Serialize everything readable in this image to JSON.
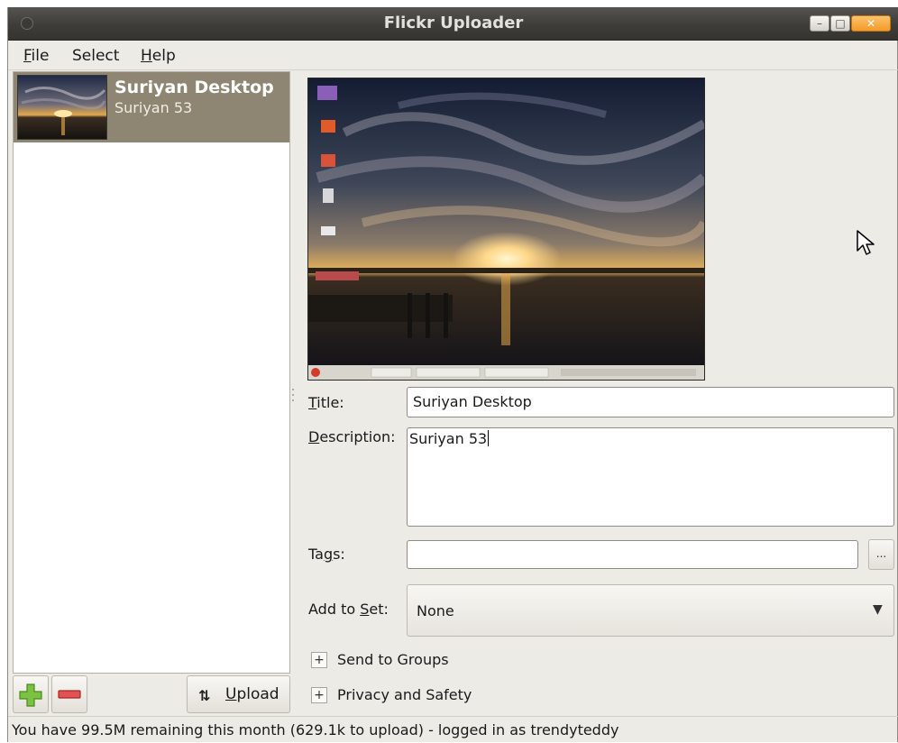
{
  "window": {
    "title": "Flickr Uploader",
    "menu": [
      {
        "label": "File",
        "mnemonic": "F",
        "rest": "ile"
      },
      {
        "label": "Select",
        "mnemonic": "",
        "rest": "Select"
      },
      {
        "label": "Help",
        "mnemonic": "H",
        "rest": "elp"
      }
    ]
  },
  "photos": [
    {
      "title": "Suriyan Desktop",
      "subtitle": "Suriyan 53",
      "selected": true
    }
  ],
  "toolbar": {
    "add_icon": "plus-icon",
    "remove_icon": "minus-icon",
    "upload_label": "Upload",
    "upload_mnemonic": "U",
    "upload_rest": "pload"
  },
  "form": {
    "title_label": {
      "mnemonic": "T",
      "rest": "itle:"
    },
    "title_value": "Suriyan Desktop",
    "description_label": {
      "mnemonic": "D",
      "rest": "escription:"
    },
    "description_value": "Suriyan 53",
    "tags_label": {
      "pre": "Ta",
      "mnemonic": "g",
      "rest": "s:"
    },
    "tags_value": "",
    "tags_more_label": "...",
    "set_label": {
      "pre": "Add to ",
      "mnemonic": "S",
      "rest": "et:"
    },
    "set_value": "None",
    "groups_label": "Send to Groups",
    "privacy_label": "Privacy and Safety"
  },
  "status": "You have 99.5M remaining this month (629.1k to upload) - logged in as trendyteddy",
  "colors": {
    "selection": "#8f8573",
    "window_bg": "#ecebe6",
    "titlebar": "#3e3d3a",
    "close_button": "#f49a27"
  }
}
